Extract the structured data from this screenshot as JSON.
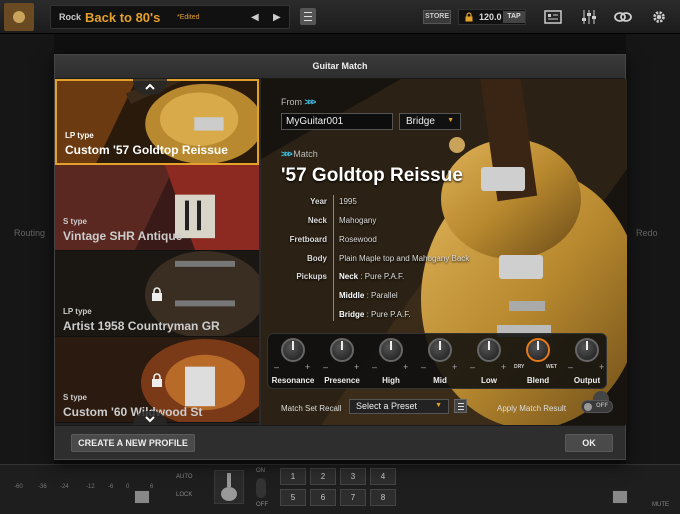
{
  "topbar": {
    "preset_category": "Rock",
    "preset_name": "Back to 80's",
    "preset_edited": "*Edited",
    "prev_icon": "◀",
    "next_icon": "▶",
    "store_label": "STORE",
    "bpm": "120.0",
    "tap_label": "TAP"
  },
  "background": {
    "routing_label": "Routing",
    "redo_label": "Redo"
  },
  "bottombar": {
    "db_scale": [
      "-60",
      "-36",
      "-24",
      "-12",
      "-6",
      "0",
      "6"
    ],
    "auto_label": "AUTO",
    "lock_label": "LOCK",
    "on_label": "ON",
    "off_label": "OFF",
    "numpad": [
      "1",
      "2",
      "3",
      "4",
      "5",
      "6",
      "7",
      "8"
    ],
    "mute_label": "MUTE"
  },
  "modal": {
    "title": "Guitar Match",
    "list": [
      {
        "type": "LP type",
        "name": "Custom '57 Goldtop Reissue",
        "selected": true,
        "locked": false
      },
      {
        "type": "S type",
        "name": "Vintage SHR Antique",
        "selected": false,
        "locked": false
      },
      {
        "type": "LP type",
        "name": "Artist 1958 Countryman GR",
        "selected": false,
        "locked": true
      },
      {
        "type": "S type",
        "name": "Custom '60 Wildwood St",
        "selected": false,
        "locked": true
      }
    ],
    "from_label": "From",
    "from_value": "MyGuitar001",
    "pickup_position": "Bridge",
    "match_label": "Match",
    "match_name": "'57 Goldtop Reissue",
    "specs": {
      "year_k": "Year",
      "year_v": "1995",
      "neck_k": "Neck",
      "neck_v": "Mahogany",
      "fretboard_k": "Fretboard",
      "fretboard_v": "Rosewood",
      "body_k": "Body",
      "body_v": "Plain Maple top and Mahogany Back",
      "pickups_k": "Pickups",
      "pickup_neck_k": "Neck",
      "pickup_neck_v": " : Pure P.A.F.",
      "pickup_middle_k": "Middle",
      "pickup_middle_v": " : Parallel",
      "pickup_bridge_k": "Bridge",
      "pickup_bridge_v": " : Pure P.A.F."
    },
    "knobs": [
      {
        "label": "Resonance"
      },
      {
        "label": "Presence"
      },
      {
        "label": "High"
      },
      {
        "label": "Mid"
      },
      {
        "label": "Low"
      },
      {
        "label": "Blend"
      },
      {
        "label": "Output"
      }
    ],
    "knob_min": "–",
    "knob_max": "+",
    "blend_dry": "DRY",
    "blend_wet": "WET",
    "recall_label": "Match Set Recall",
    "recall_placeholder": "Select a Preset",
    "apply_label": "Apply Match Result",
    "apply_state": "OFF",
    "create_label": "CREATE A NEW PROFILE",
    "ok_label": "OK"
  },
  "colors": {
    "accent_orange": "#e3a12c",
    "chevron_cyan": "#3ec6e8",
    "gold_guitar": "#b8892e"
  }
}
